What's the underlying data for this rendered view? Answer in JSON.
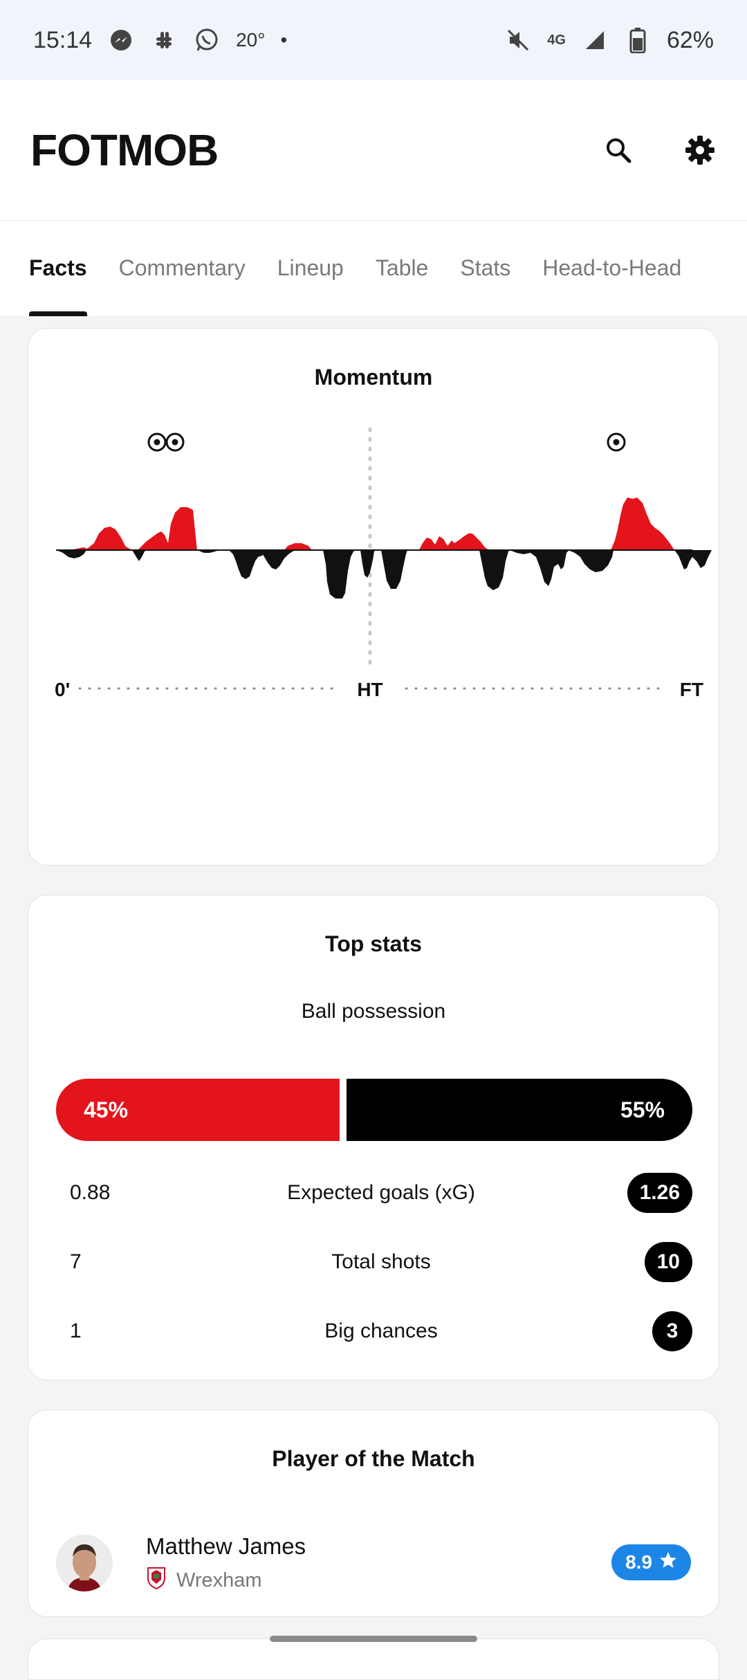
{
  "status_bar": {
    "time": "15:14",
    "temperature": "20°",
    "battery": "62%",
    "network": "4G",
    "left_icons": [
      "messenger-icon",
      "slack-icon",
      "whatsapp-icon"
    ],
    "right_icons": [
      "mute-icon",
      "signal-icon",
      "battery-icon"
    ]
  },
  "header": {
    "logo": "FOTMOB",
    "actions": [
      "search-icon",
      "settings-icon"
    ]
  },
  "tabs": [
    {
      "label": "Facts",
      "active": true
    },
    {
      "label": "Commentary",
      "active": false
    },
    {
      "label": "Lineup",
      "active": false
    },
    {
      "label": "Table",
      "active": false
    },
    {
      "label": "Stats",
      "active": false
    },
    {
      "label": "Head-to-Head",
      "active": false
    }
  ],
  "momentum": {
    "title": "Momentum",
    "axis_labels": {
      "start": "0'",
      "half": "HT",
      "end": "FT"
    },
    "home_color": "#e3141c",
    "away_color": "#111111",
    "goal_icons": "football-icon"
  },
  "top_stats": {
    "title": "Top stats",
    "possession": {
      "label": "Ball possession",
      "home": "45%",
      "away": "55%",
      "home_share": 0.45
    },
    "rows": [
      {
        "label": "Expected goals (xG)",
        "home": "0.88",
        "away": "1.26"
      },
      {
        "label": "Total shots",
        "home": "7",
        "away": "10"
      },
      {
        "label": "Big chances",
        "home": "1",
        "away": "3"
      }
    ]
  },
  "player_of_match": {
    "title": "Player of the Match",
    "name": "Matthew James",
    "team": "Wrexham",
    "rating": "8.9",
    "rating_color": "#1c86e6"
  }
}
